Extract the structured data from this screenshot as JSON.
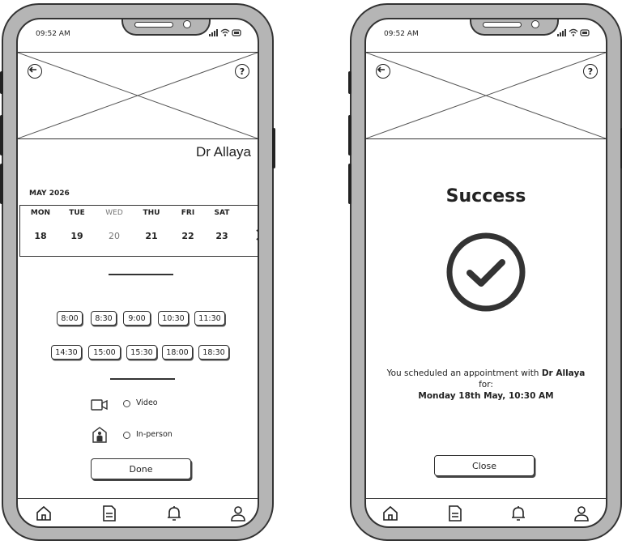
{
  "status_bar": {
    "time": "09:52 AM",
    "icons": "▐▐ ◕ ▭"
  },
  "booking": {
    "doctor_name": "Dr Allaya",
    "month_label": "MAY 2026",
    "days": [
      {
        "name": "MON",
        "date": "18",
        "muted": false
      },
      {
        "name": "TUE",
        "date": "19",
        "muted": false
      },
      {
        "name": "WED",
        "date": "20",
        "muted": true
      },
      {
        "name": "THU",
        "date": "21",
        "muted": false
      },
      {
        "name": "FRI",
        "date": "22",
        "muted": false
      },
      {
        "name": "SAT",
        "date": "23",
        "muted": false
      }
    ],
    "morning_slots": [
      "8:00",
      "8:30",
      "9:00",
      "10:30",
      "11:30"
    ],
    "afternoon_slots": [
      "14:30",
      "15:00",
      "15:30",
      "18:00",
      "18:30"
    ],
    "options": [
      {
        "label": "Video",
        "icon": "video-camera-icon"
      },
      {
        "label": "In-person",
        "icon": "in-person-icon"
      }
    ],
    "done_label": "Done"
  },
  "confirmation": {
    "title": "Success",
    "message_prefix": "You scheduled an appointment with",
    "doctor_name": "Dr Allaya",
    "message_for": "for:",
    "date_time": "Monday 18th May, 10:30 AM",
    "close_label": "Close"
  },
  "nav_icons": [
    "home-icon",
    "document-icon",
    "bell-icon",
    "user-icon"
  ]
}
